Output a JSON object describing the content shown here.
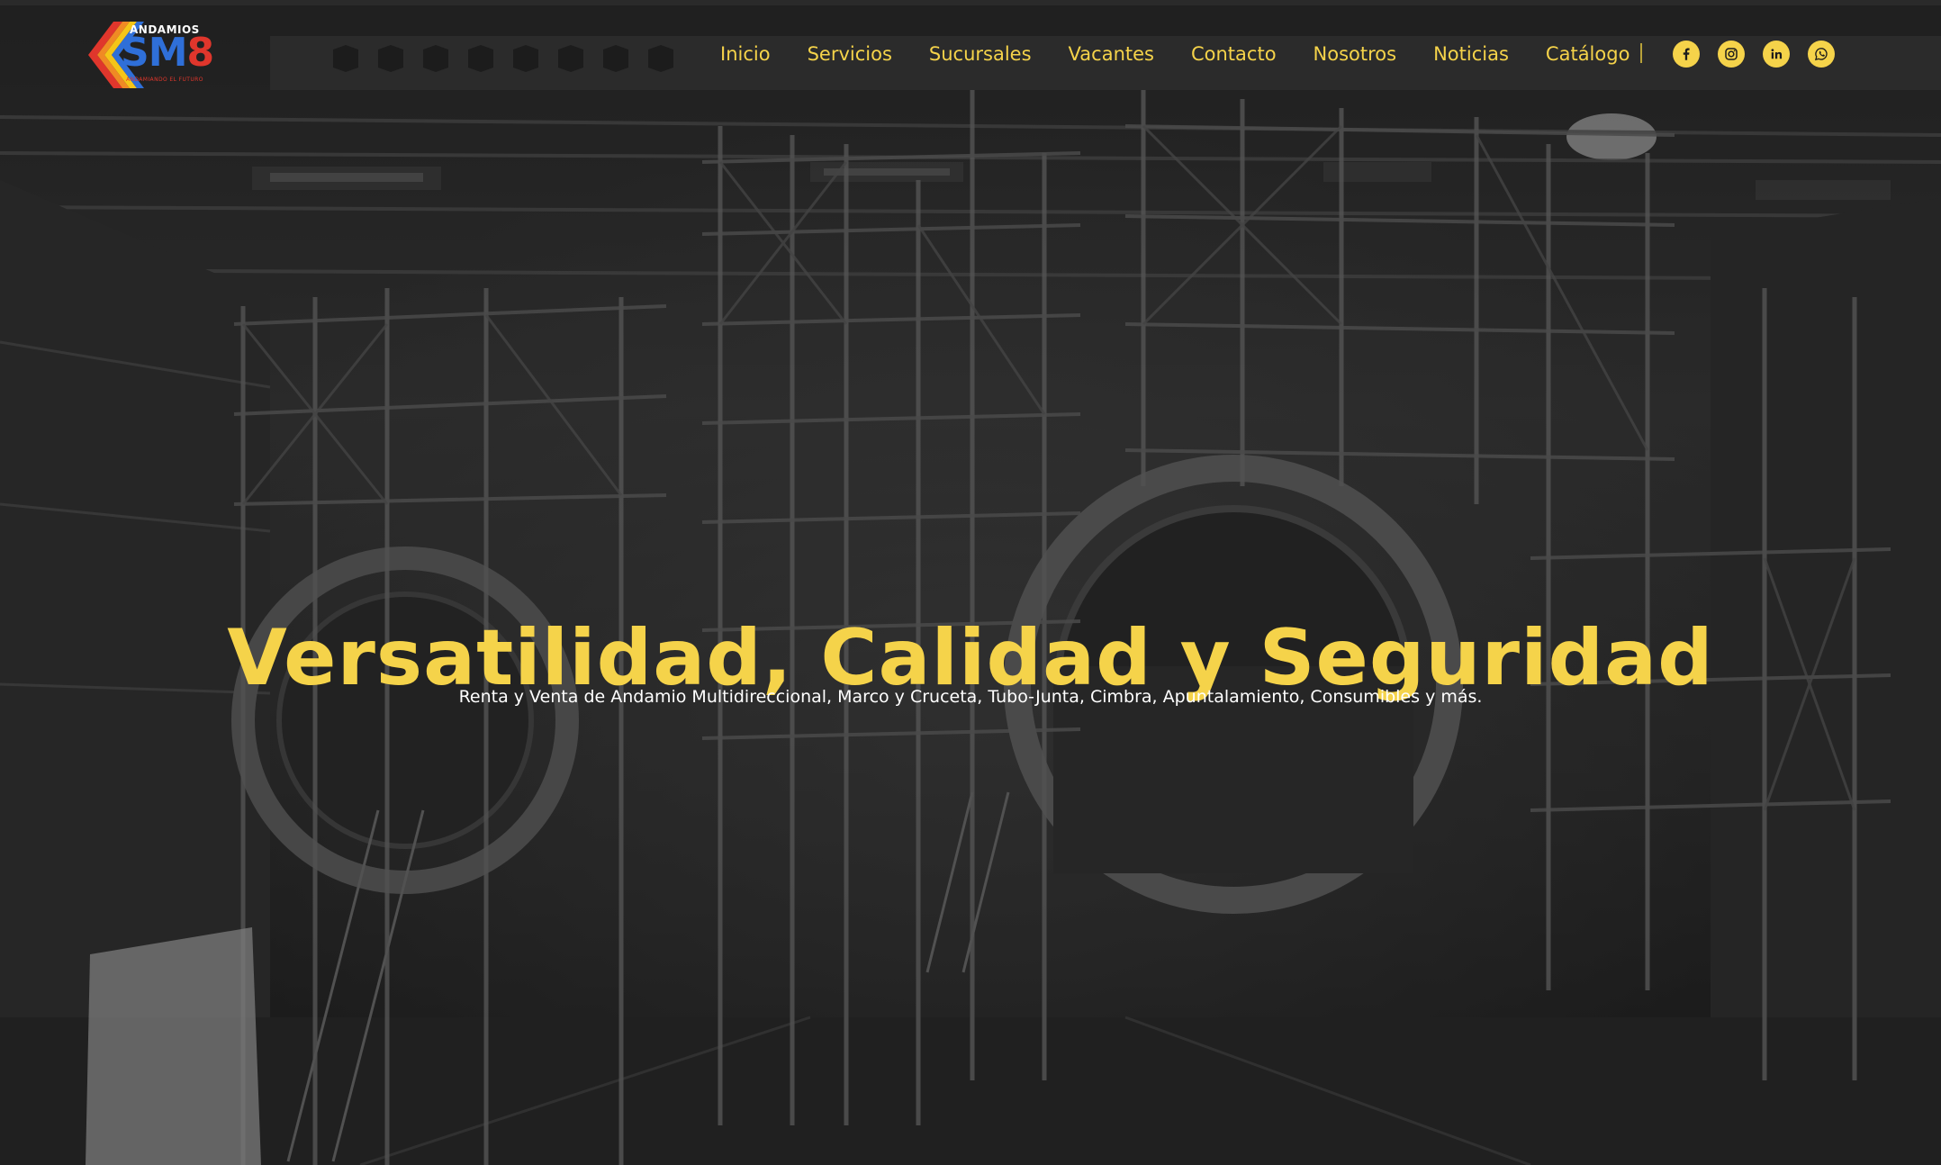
{
  "brand": {
    "logo_top": "ANDAMIOS",
    "logo_main": "SM",
    "logo_number": "8",
    "logo_tagline": "ANDAMIANDO EL FUTURO",
    "colors": {
      "accent": "#f5d34a",
      "logo_blue": "#2f6fd8",
      "logo_red": "#e0362c",
      "logo_orange": "#f08a24",
      "logo_yellow": "#f5c518"
    }
  },
  "nav": {
    "items": [
      {
        "label": "Inicio"
      },
      {
        "label": "Servicios"
      },
      {
        "label": "Sucursales"
      },
      {
        "label": "Vacantes"
      },
      {
        "label": "Contacto"
      },
      {
        "label": "Nosotros"
      },
      {
        "label": "Noticias"
      },
      {
        "label": "Catálogo"
      }
    ]
  },
  "social": {
    "icons": [
      "facebook-icon",
      "instagram-icon",
      "linkedin-icon",
      "whatsapp-icon"
    ]
  },
  "hero": {
    "title": "Versatilidad, Calidad y Seguridad",
    "subtitle": "Renta y Venta de Andamio Multidireccional, Marco y Cruceta, Tubo-Junta, Cimbra, Apuntalamiento, Consumibles y más."
  }
}
